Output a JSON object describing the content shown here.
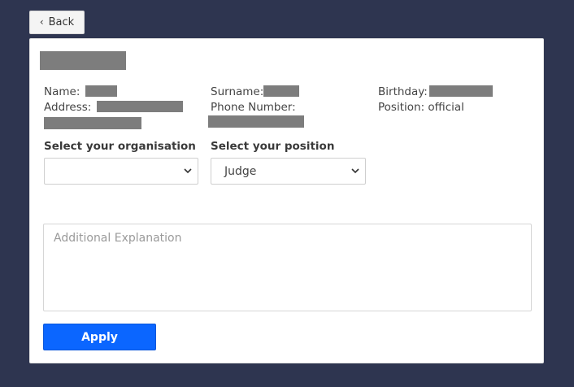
{
  "back": {
    "label": "Back"
  },
  "info": {
    "name_label": "Name:",
    "surname_label": "Surname:",
    "birthday_label": "Birthday:",
    "address_label": "Address:",
    "phone_label": "Phone Number:",
    "position_label": "Position:",
    "position_value": "official"
  },
  "organisation": {
    "label": "Select your organisation",
    "value": ""
  },
  "position_select": {
    "label": "Select your position",
    "value": "Judge"
  },
  "explanation": {
    "placeholder": "Additional Explanation"
  },
  "apply": {
    "label": "Apply"
  },
  "colors": {
    "background": "#2e3550",
    "accent": "#0b66ff",
    "redaction": "#7d7d7d"
  }
}
